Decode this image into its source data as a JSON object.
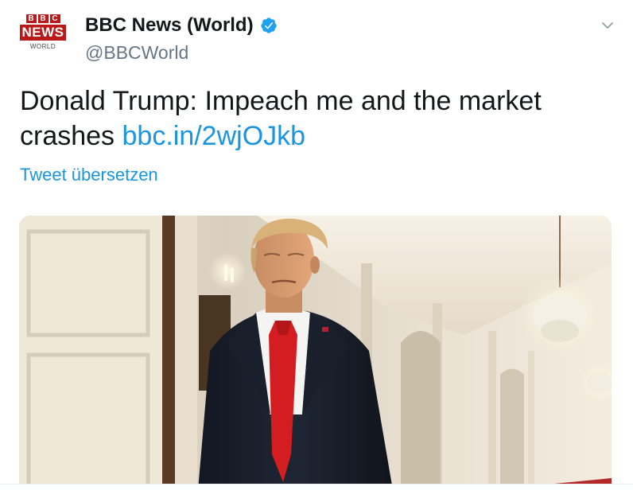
{
  "account": {
    "display_name": "BBC News (World)",
    "handle": "@BBCWorld",
    "verified": true,
    "avatar": {
      "logo_letters": [
        "B",
        "B",
        "C"
      ],
      "logo_word": "NEWS",
      "logo_subtitle": "WORLD"
    }
  },
  "tweet": {
    "text_before_link": "Donald Trump: Impeach me and the market crashes ",
    "link": "bbc.in/2wjOJkb",
    "translate_label": "Tweet übersetzen"
  },
  "media": {
    "description_icon": "photo"
  },
  "icons": {
    "verified": "verified-badge-icon",
    "menu": "chevron-down-icon"
  },
  "colors": {
    "link": "#1b95e0",
    "text": "#14171a",
    "muted": "#657786",
    "bbc_red": "#bb1919",
    "verified": "#1da1f2"
  }
}
